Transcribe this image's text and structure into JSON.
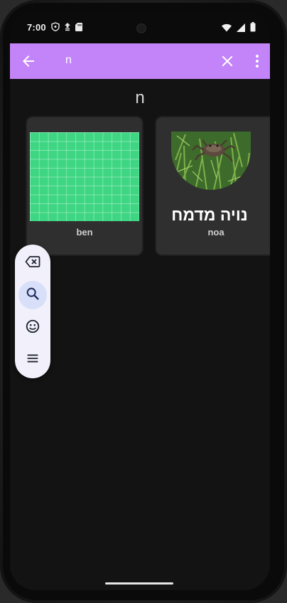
{
  "status_bar": {
    "time": "7:00",
    "icons_left": [
      "vpn-shield-icon",
      "data-saver-icon",
      "sd-card-icon"
    ],
    "icons_right": [
      "wifi-icon",
      "signal-icon",
      "battery-icon"
    ]
  },
  "toolbar": {
    "query": "n",
    "back_icon": "arrow-back-icon",
    "clear_icon": "close-icon",
    "more_icon": "more-vert-icon",
    "background": "#c384f9"
  },
  "results": {
    "section_title": "n",
    "cards": [
      {
        "label": "ben",
        "thumbnail": "green-grid"
      },
      {
        "label": "noa",
        "thumbnail": "crab-photo",
        "overlay_text": "נויה מדמח"
      }
    ]
  },
  "floating_toolbar": {
    "buttons": [
      {
        "icon": "backspace-icon",
        "active": false
      },
      {
        "icon": "search-icon",
        "active": true
      },
      {
        "icon": "emoji-icon",
        "active": false
      },
      {
        "icon": "menu-icon",
        "active": false
      }
    ]
  }
}
